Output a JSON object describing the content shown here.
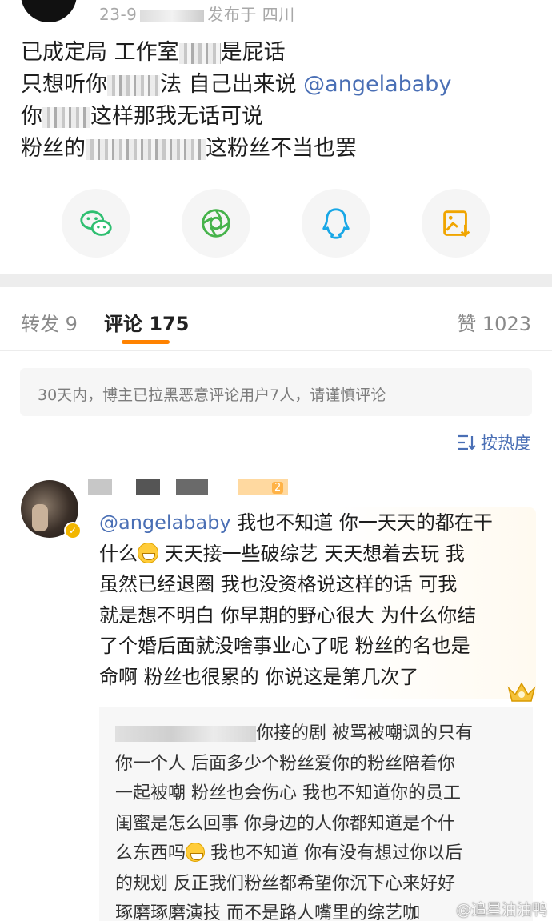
{
  "post": {
    "meta_date": "23-9",
    "meta_location": "发布于 四川",
    "lines": [
      {
        "a": "已成定局 工作室",
        "b": "是屁话"
      },
      {
        "a": "只想听你",
        "b": "法 自己出来说 ",
        "mention": "@angelababy"
      },
      {
        "a": "你",
        "b": "这样那我无话可说"
      },
      {
        "a": "粉丝的",
        "b": "这粉丝不当也罢"
      }
    ]
  },
  "share": {
    "items": [
      {
        "name": "wechat",
        "icon": "wechat-icon",
        "color": "#2fbf71"
      },
      {
        "name": "moments",
        "icon": "moments-icon",
        "color": "#46b34b"
      },
      {
        "name": "qq",
        "icon": "qq-icon",
        "color": "#18a7e6"
      },
      {
        "name": "save-image",
        "icon": "save-image-icon",
        "color": "#f0a500"
      }
    ]
  },
  "tabs": {
    "repost": "转发 9",
    "comments": "评论 175",
    "likes": "赞 1023"
  },
  "notice": "30天内，博主已拉黑恶意评论用户7人，请谨慎评论",
  "sort": {
    "label": "按热度",
    "icon": "sort-icon"
  },
  "comment": {
    "level_badge": "2",
    "lines": [
      {
        "mention": "@angelababy",
        "text": " 我也不知道 你一天天的都在干"
      },
      {
        "pre": "什么",
        "post": " 天天接一些破综艺 天天想着去玩 我"
      },
      {
        "text": "虽然已经退圈 我也没资格说这样的话  可我"
      },
      {
        "text": "就是想不明白 你早期的野心很大 为什么你结"
      },
      {
        "text": "了个婚后面就没啥事业心了呢 粉丝的名也是"
      },
      {
        "text": "命啊 粉丝也很累的 你说这是第几次了"
      }
    ]
  },
  "reply": {
    "lines": [
      {
        "text": "你接的剧 被骂被嘲讽的只有"
      },
      {
        "text": "你一个人 后面多少个粉丝爱你的粉丝陪着你"
      },
      {
        "text": "一起被嘲  粉丝也会伤心 我也不知道你的员工"
      },
      {
        "text": "闺蜜是怎么回事 你身边的人你都知道是个什"
      },
      {
        "pre": "么东西吗",
        "post": " 我也不知道 你有没有想过你以后"
      },
      {
        "text": "的规划 反正我们粉丝都希望你沉下心来好好"
      },
      {
        "text": "琢磨琢磨演技  而不是路人嘴里的综艺咖"
      }
    ]
  },
  "watermark": "@追星油油鸭"
}
